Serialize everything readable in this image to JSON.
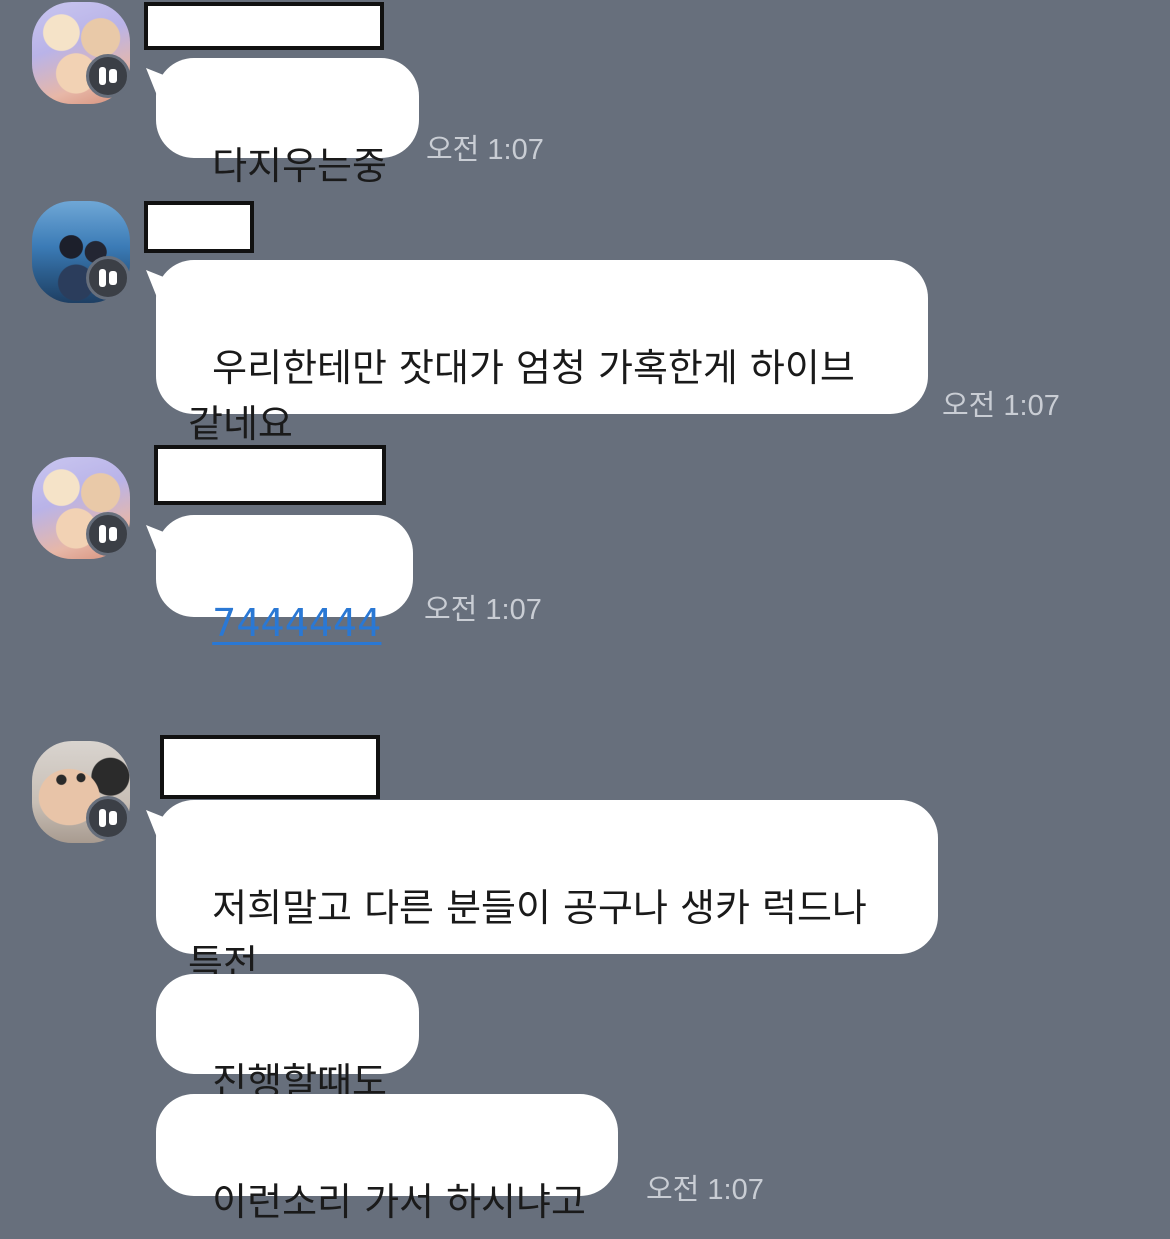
{
  "messages": [
    {
      "text": "다지우는중",
      "time": "오전 1:07"
    },
    {
      "text": "우리한테만 잣대가 엄청 가혹한게 하이브\n같네요",
      "time": "오전 1:07"
    },
    {
      "text": "7444444",
      "time": "오전 1:07"
    },
    {
      "text": "저희말고 다른 분들이 공구나 생카 럭드나\n특전"
    },
    {
      "text": "진행할때도"
    },
    {
      "text": "이런소리 가서 하시냐고",
      "time": "오전 1:07"
    }
  ],
  "colors": {
    "background": "#676f7c",
    "bubble": "#ffffff",
    "link": "#2a78d4",
    "timestamp": "#c9cdd4"
  },
  "icons": {
    "badge": "profile-badge-icon",
    "avatar": "avatar-image"
  }
}
